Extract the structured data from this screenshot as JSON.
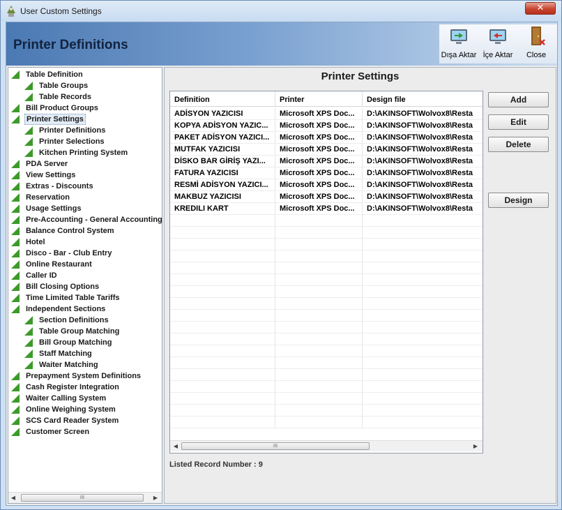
{
  "window": {
    "title": "User Custom Settings",
    "close_glyph": "✕"
  },
  "header": {
    "title": "Printer Definitions"
  },
  "toolbar": {
    "export_label": "Dışa Aktar",
    "import_label": "İçe Aktar",
    "close_label": "Close"
  },
  "tree": {
    "items": [
      {
        "label": "Table Definition",
        "level": 0
      },
      {
        "label": "Table Groups",
        "level": 1
      },
      {
        "label": "Table Records",
        "level": 1
      },
      {
        "label": "Bill Product Groups",
        "level": 0
      },
      {
        "label": "Printer Settings",
        "level": 0,
        "selected": true
      },
      {
        "label": "Printer Definitions",
        "level": 1
      },
      {
        "label": "Printer Selections",
        "level": 1
      },
      {
        "label": "Kitchen Printing System",
        "level": 1
      },
      {
        "label": "PDA Server",
        "level": 0
      },
      {
        "label": "View Settings",
        "level": 0
      },
      {
        "label": "Extras - Discounts",
        "level": 0
      },
      {
        "label": "Reservation",
        "level": 0
      },
      {
        "label": "Usage Settings",
        "level": 0
      },
      {
        "label": "Pre-Accounting - General Accounting",
        "level": 0
      },
      {
        "label": "Balance Control System",
        "level": 0
      },
      {
        "label": "Hotel",
        "level": 0
      },
      {
        "label": "Disco - Bar - Club Entry",
        "level": 0
      },
      {
        "label": "Online Restaurant",
        "level": 0
      },
      {
        "label": "Caller ID",
        "level": 0
      },
      {
        "label": "Bill Closing Options",
        "level": 0
      },
      {
        "label": "Time Limited Table Tariffs",
        "level": 0
      },
      {
        "label": "Independent Sections",
        "level": 0
      },
      {
        "label": "Section Definitions",
        "level": 1
      },
      {
        "label": "Table Group Matching",
        "level": 1
      },
      {
        "label": "Bill Group Matching",
        "level": 1
      },
      {
        "label": "Staff Matching",
        "level": 1
      },
      {
        "label": "Waiter Matching",
        "level": 1
      },
      {
        "label": "Prepayment System Definitions",
        "level": 0
      },
      {
        "label": "Cash Register Integration",
        "level": 0
      },
      {
        "label": "Waiter Calling System",
        "level": 0
      },
      {
        "label": "Online Weighing System",
        "level": 0
      },
      {
        "label": "SCS Card Reader System",
        "level": 0
      },
      {
        "label": "Customer Screen",
        "level": 0
      }
    ]
  },
  "panel": {
    "title": "Printer Settings",
    "columns": [
      "Definition",
      "Printer",
      "Design file"
    ],
    "rows": [
      [
        "ADİSYON YAZICISI",
        "Microsoft XPS Doc...",
        "D:\\AKINSOFT\\Wolvox8\\Resta"
      ],
      [
        "KOPYA ADİSYON YAZIC...",
        "Microsoft XPS Doc...",
        "D:\\AKINSOFT\\Wolvox8\\Resta"
      ],
      [
        "PAKET ADİSYON YAZICI...",
        "Microsoft XPS Doc...",
        "D:\\AKINSOFT\\Wolvox8\\Resta"
      ],
      [
        "MUTFAK YAZICISI",
        "Microsoft XPS Doc...",
        "D:\\AKINSOFT\\Wolvox8\\Resta"
      ],
      [
        "DİSKO BAR GİRİŞ YAZI...",
        "Microsoft XPS Doc...",
        "D:\\AKINSOFT\\Wolvox8\\Resta"
      ],
      [
        "FATURA YAZICISI",
        "Microsoft XPS Doc...",
        "D:\\AKINSOFT\\Wolvox8\\Resta"
      ],
      [
        "RESMİ ADİSYON YAZICI...",
        "Microsoft XPS Doc...",
        "D:\\AKINSOFT\\Wolvox8\\Resta"
      ],
      [
        "MAKBUZ YAZICISI",
        "Microsoft XPS Doc...",
        "D:\\AKINSOFT\\Wolvox8\\Resta"
      ],
      [
        "KREDILI KART",
        "Microsoft XPS Doc...",
        "D:\\AKINSOFT\\Wolvox8\\Resta"
      ]
    ],
    "empty_row_count": 18,
    "buttons": {
      "add": "Add",
      "edit": "Edit",
      "delete": "Delete",
      "design": "Design"
    },
    "record_label": "Listed Record Number : 9"
  },
  "scrollbars": {
    "left_arrow": "◀",
    "right_arrow": "▶",
    "grip": "III"
  },
  "colors": {
    "tree_triangle": "#3d9a2a",
    "header_band": "#4b79b3"
  }
}
